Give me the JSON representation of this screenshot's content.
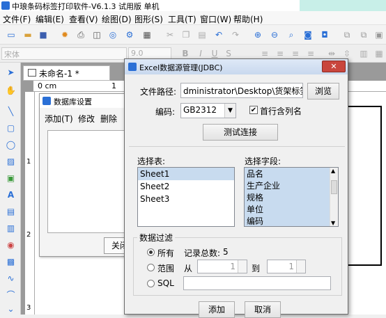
{
  "window": {
    "title": "中琅条码标签打印软件-V6.1.3 试用版 单机"
  },
  "menu": [
    "文件(F)",
    "编辑(E)",
    "查看(V)",
    "绘图(D)",
    "图形(S)",
    "工具(T)",
    "窗口(W)",
    "帮助(H)"
  ],
  "toolbar2": {
    "font": "宋体",
    "size": "9.0"
  },
  "document": {
    "tab_label": "未命名-1 *",
    "ruler_unit": "0 cm",
    "ruler_marks": [
      "1",
      "1",
      "2",
      "3"
    ]
  },
  "db_settings": {
    "title": "数据库设置",
    "menu": [
      "添加(T)",
      "修改",
      "删除"
    ],
    "close_button": "关闭"
  },
  "excel_dialog": {
    "title": "Excel数据源管理(JDBC)",
    "close_glyph": "✕",
    "file_path_label": "文件路径:",
    "file_path_value": "dministrator\\Desktop\\货架标签.xlsx",
    "browse_button": "浏览",
    "encoding_label": "编码:",
    "encoding_value": "GB2312",
    "first_row_label": "首行含列名",
    "first_row_checked": true,
    "test_button": "测试连接",
    "select_table_label": "选择表:",
    "tables": [
      "Sheet1",
      "Sheet2",
      "Sheet3"
    ],
    "selected_table": "Sheet1",
    "select_field_label": "选择字段:",
    "fields": [
      "品名",
      "生产企业",
      "规格",
      "单位",
      "编码"
    ],
    "filter_title": "数据过滤",
    "filter_all": "所有",
    "record_count_label": "记录总数:",
    "record_count": "5",
    "filter_range": "范围",
    "from_label": "从",
    "from_value": "1",
    "to_label": "到",
    "to_value": "1",
    "filter_sql": "SQL",
    "add_button": "添加",
    "cancel_button": "取消"
  },
  "colors": {
    "accent": "#2a6fd6",
    "selection": "#c8dbef",
    "close": "#c9463d"
  }
}
